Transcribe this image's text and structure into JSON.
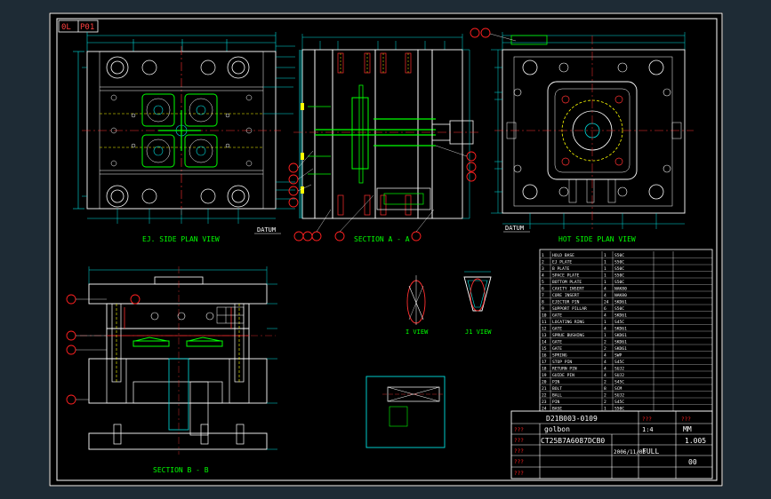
{
  "sheet": {
    "tag_left": "0L",
    "tag_right": "P01"
  },
  "views": {
    "ej_side": "EJ. SIDE PLAN VIEW",
    "section_aa": "SECTION A - A",
    "hot_side": "HOT SIDE PLAN VIEW",
    "section_bb": "SECTION B - B",
    "i_view": "I VIEW",
    "j_view": "J1 VIEW",
    "datum_left": "DATUM",
    "datum_right": "DATUM"
  },
  "title_block": {
    "drawing_no": "D21B003-0109",
    "customer": "golbon",
    "part_no": "CT25B7A6087DCB0",
    "date": "2006/11/03",
    "scale": "FULL",
    "unit": "MM",
    "sheet_no": "1.005",
    "rev": "00",
    "qty": "1:4",
    "mark": "???"
  },
  "bom": {
    "rows": [
      {
        "no": "1",
        "name": "HOLD BASE",
        "qty": "1",
        "mat": "S50C"
      },
      {
        "no": "2",
        "name": "EJ PLATE",
        "qty": "1",
        "mat": "S50C"
      },
      {
        "no": "3",
        "name": "B PLATE",
        "qty": "1",
        "mat": "S50C"
      },
      {
        "no": "4",
        "name": "SPACE PLATE",
        "qty": "1",
        "mat": "S50C"
      },
      {
        "no": "5",
        "name": "BOTTOM PLATE",
        "qty": "1",
        "mat": "S50C"
      },
      {
        "no": "6",
        "name": "CAVITY INSERT",
        "qty": "4",
        "mat": "NAK80"
      },
      {
        "no": "7",
        "name": "CORE INSERT",
        "qty": "4",
        "mat": "NAK80"
      },
      {
        "no": "8",
        "name": "EJECTOR PIN",
        "qty": "24",
        "mat": "SKD61"
      },
      {
        "no": "9",
        "name": "SUPPORT PILLAR",
        "qty": "6",
        "mat": "S50C"
      },
      {
        "no": "10",
        "name": "GATE",
        "qty": "4",
        "mat": "SKD61"
      },
      {
        "no": "11",
        "name": "LOCATING RING",
        "qty": "1",
        "mat": "S45C"
      },
      {
        "no": "12",
        "name": "GATE",
        "qty": "4",
        "mat": "SKD61"
      },
      {
        "no": "13",
        "name": "SPRUE BUSHING",
        "qty": "1",
        "mat": "SKD61"
      },
      {
        "no": "14",
        "name": "GATE",
        "qty": "2",
        "mat": "SKD61"
      },
      {
        "no": "15",
        "name": "GATE",
        "qty": "2",
        "mat": "SKD61"
      },
      {
        "no": "16",
        "name": "SPRING",
        "qty": "4",
        "mat": "SWP"
      },
      {
        "no": "17",
        "name": "STOP PIN",
        "qty": "4",
        "mat": "S45C"
      },
      {
        "no": "18",
        "name": "RETURN PIN",
        "qty": "4",
        "mat": "SUJ2"
      },
      {
        "no": "19",
        "name": "GUIDE PIN",
        "qty": "4",
        "mat": "SUJ2"
      },
      {
        "no": "20",
        "name": "PIN",
        "qty": "2",
        "mat": "S45C"
      },
      {
        "no": "21",
        "name": "BOLT",
        "qty": "8",
        "mat": "SCM"
      },
      {
        "no": "22",
        "name": "BALL",
        "qty": "2",
        "mat": "SUJ2"
      },
      {
        "no": "23",
        "name": "PIN",
        "qty": "2",
        "mat": "S45C"
      },
      {
        "no": "24",
        "name": "BASE",
        "qty": "1",
        "mat": "S50C"
      }
    ]
  },
  "colors": {
    "paper": "#000000",
    "frame": "#ffffff",
    "outline": "#ffffff",
    "dimension": "#00e0e0",
    "part": "#00ff00",
    "callout": "#ff2020",
    "hidden": "#ffff00",
    "center": "#ff3030",
    "title_text": "#ffffff",
    "sheet_tag": "#ff4040",
    "background": "#1e2b35"
  }
}
